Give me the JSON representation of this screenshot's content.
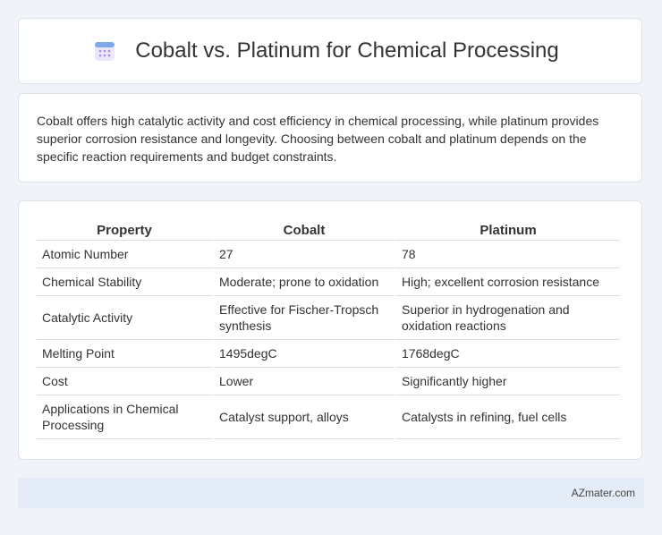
{
  "header": {
    "title": "Cobalt vs. Platinum for Chemical Processing",
    "icon": "calendar-icon"
  },
  "intro": "Cobalt offers high catalytic activity and cost efficiency in chemical processing, while platinum provides superior corrosion resistance and longevity. Choosing between cobalt and platinum depends on the specific reaction requirements and budget constraints.",
  "table": {
    "headers": [
      "Property",
      "Cobalt",
      "Platinum"
    ],
    "rows": [
      [
        "Atomic Number",
        "27",
        "78"
      ],
      [
        "Chemical Stability",
        "Moderate; prone to oxidation",
        "High; excellent corrosion resistance"
      ],
      [
        "Catalytic Activity",
        "Effective for Fischer-Tropsch synthesis",
        "Superior in hydrogenation and oxidation reactions"
      ],
      [
        "Melting Point",
        "1495degC",
        "1768degC"
      ],
      [
        "Cost",
        "Lower",
        "Significantly higher"
      ],
      [
        "Applications in Chemical Processing",
        "Catalyst support, alloys",
        "Catalysts in refining, fuel cells"
      ]
    ]
  },
  "footer": {
    "brand": "AZmater.com"
  },
  "colors": {
    "background": "#f0f4f9",
    "card": "#ffffff",
    "footer": "#e4ecf7",
    "icon_top": "#7fa8e8",
    "icon_body": "#c7b8f0"
  }
}
